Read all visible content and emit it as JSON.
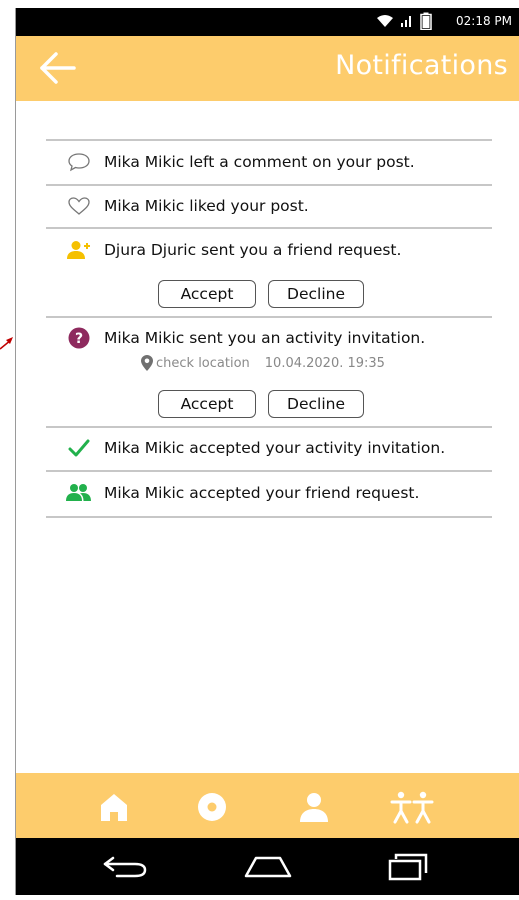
{
  "status": {
    "time": "02:18 PM"
  },
  "header": {
    "title": "Notifications"
  },
  "notifications": [
    {
      "text": "Mika Mikic left a comment on your post.",
      "icon": "comment-icon"
    },
    {
      "text": "Mika Mikic liked your post.",
      "icon": "heart-icon"
    },
    {
      "text": "Djura Djuric sent you a friend request.",
      "icon": "add-friend-icon"
    },
    {
      "text": "Mika Mikic sent you an activity invitation.",
      "icon": "question-icon",
      "location_label": "check location",
      "date": "10.04.2020. 19:35"
    },
    {
      "text": "Mika Mikic accepted your activity invitation.",
      "icon": "checkmark-icon"
    },
    {
      "text": "Mika Mikic accepted your friend request.",
      "icon": "friends-icon"
    }
  ],
  "actions": {
    "accept_label": "Accept",
    "decline_label": "Decline"
  },
  "colors": {
    "accent": "#fdcc6c",
    "invite": "#8e2a5e",
    "success": "#22b14c",
    "friend_request": "#f5c000"
  }
}
